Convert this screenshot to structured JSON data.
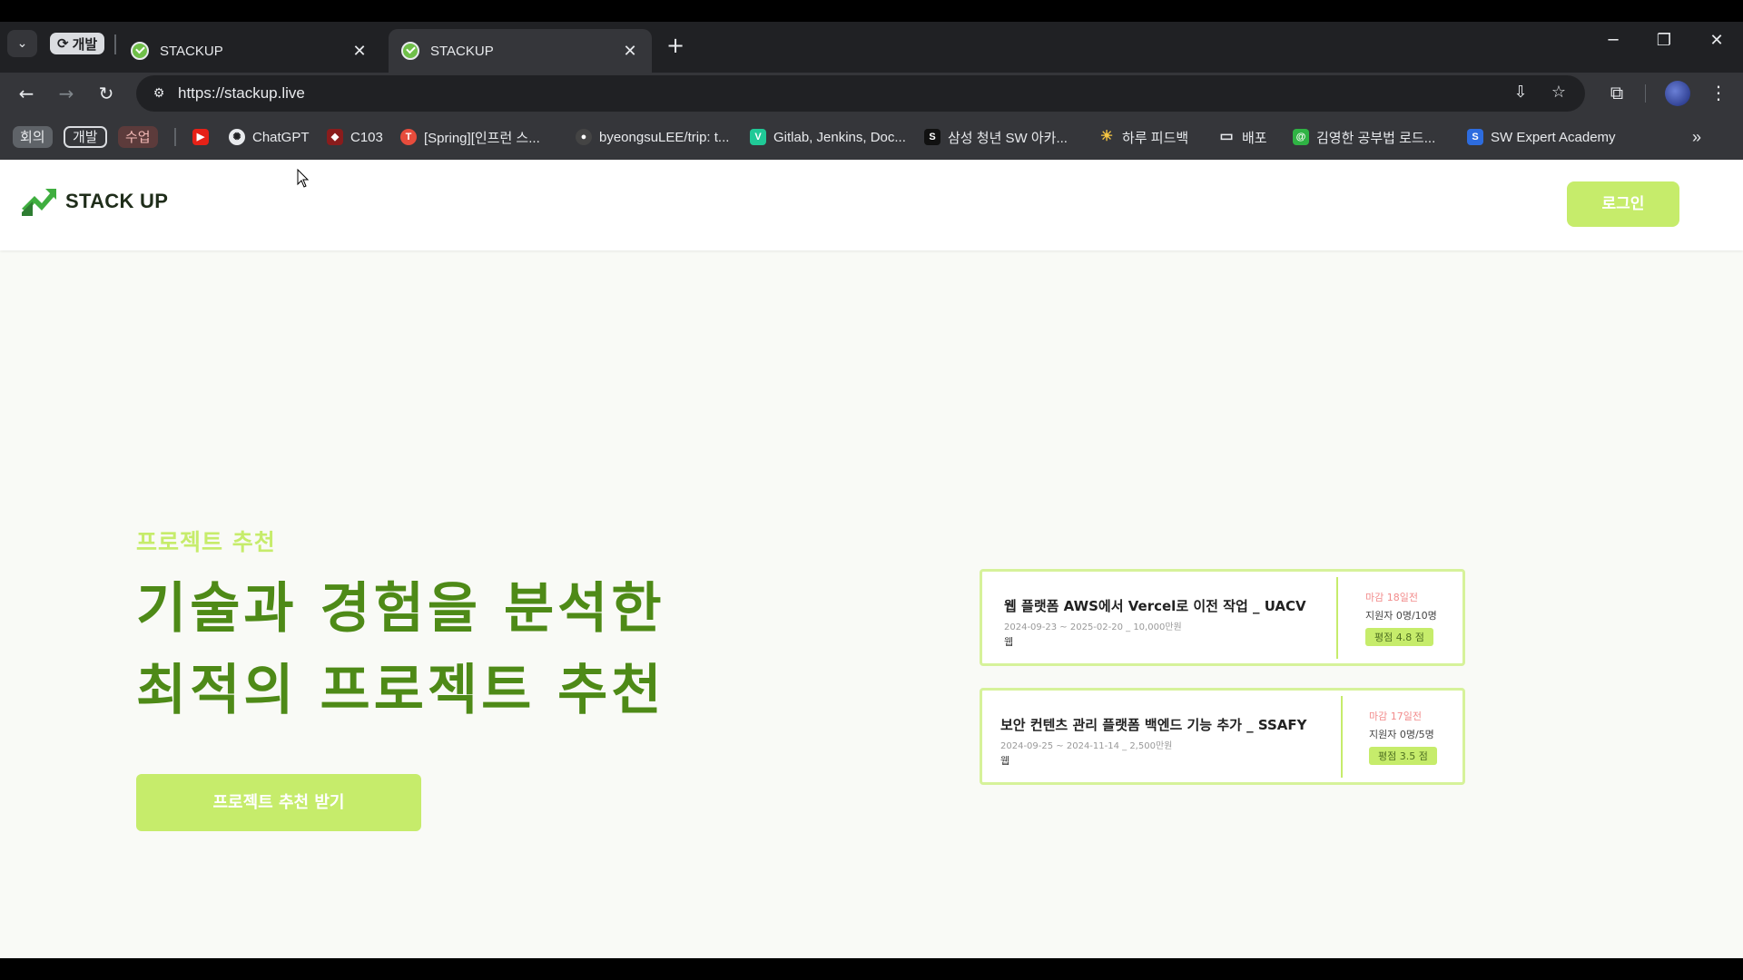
{
  "browser": {
    "tab_group_label": "개발",
    "tabs": [
      {
        "title": "STACKUP",
        "active": false
      },
      {
        "title": "STACKUP",
        "active": true
      }
    ],
    "url": "https://stackup.live",
    "bookmark_groups": [
      "회의",
      "개발",
      "수업"
    ],
    "bookmarks": [
      {
        "label": "",
        "icon": "youtube-icon"
      },
      {
        "label": "ChatGPT",
        "icon": "chatgpt-icon"
      },
      {
        "label": "C103",
        "icon": "c103-icon"
      },
      {
        "label": "[Spring][인프런 스...",
        "icon": "inflearn-icon"
      },
      {
        "label": "byeongsuLEE/trip: t...",
        "icon": "github-icon"
      },
      {
        "label": "Gitlab, Jenkins, Doc...",
        "icon": "velog-icon"
      },
      {
        "label": "삼성 청년 SW 아카...",
        "icon": "ssafy-icon"
      },
      {
        "label": "하루 피드백",
        "icon": "weather-icon"
      },
      {
        "label": "배포",
        "icon": "folder-icon"
      },
      {
        "label": "김영한 공부법 로드...",
        "icon": "notion-icon"
      },
      {
        "label": "SW Expert Academy",
        "icon": "swea-icon"
      }
    ]
  },
  "site": {
    "logo_text": "STACK UP",
    "login_label": "로그인",
    "eyebrow": "프로젝트 추천",
    "headline_line1": "기술과 경험을 분석한",
    "headline_line2": "최적의 프로젝트 추천",
    "cta_label": "프로젝트 추천 받기",
    "brand_colors": {
      "accent": "#c6ec6b",
      "headline": "#4e8a17"
    }
  },
  "cards": [
    {
      "title": "웹 플랫폼 AWS에서 Vercel로 이전 작업 _ UACV",
      "meta": "2024-09-23 ~ 2025-02-20 _ 10,000만원",
      "category": "웹",
      "deadline": "마감 18일전",
      "applicants": "지원자 0명/10명",
      "rating": "평점 4.8 점"
    },
    {
      "title": "보안 컨텐츠 관리 플랫폼 백엔드 기능 추가 _ SSAFY",
      "meta": "2024-09-25 ~ 2024-11-14 _ 2,500만원",
      "category": "웹",
      "deadline": "마감 17일전",
      "applicants": "지원자 0명/5명",
      "rating": "평점 3.5 점"
    }
  ]
}
